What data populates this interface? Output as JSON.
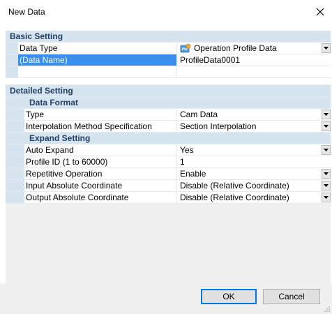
{
  "window": {
    "title": "New Data"
  },
  "categories": {
    "basic": "Basic Setting",
    "detailed": "Detailed Setting",
    "data_format": "Data Format",
    "expand": "Expand Setting"
  },
  "rows": {
    "data_type": {
      "label": "Data Type",
      "value": "Operation Profile Data",
      "icon": "profile-data-icon"
    },
    "data_name": {
      "label": "(Data Name)",
      "value": "ProfileData0001"
    },
    "type": {
      "label": "Type",
      "value": "Cam Data"
    },
    "interp": {
      "label": "Interpolation Method Specification",
      "value": "Section Interpolation"
    },
    "auto_expand": {
      "label": "Auto Expand",
      "value": "Yes"
    },
    "profile_id": {
      "label": "Profile ID (1 to 60000)",
      "value": "1"
    },
    "repetitive": {
      "label": "Repetitive Operation",
      "value": "Enable"
    },
    "input_abs": {
      "label": "Input Absolute Coordinate",
      "value": "Disable (Relative Coordinate)"
    },
    "output_abs": {
      "label": "Output Absolute Coordinate",
      "value": "Disable (Relative Coordinate)"
    }
  },
  "buttons": {
    "ok": "OK",
    "cancel": "Cancel"
  },
  "colors": {
    "category_bg": "#d6e4f0",
    "selected_bg": "#3d8ee8",
    "category_text": "#1f3f66"
  }
}
